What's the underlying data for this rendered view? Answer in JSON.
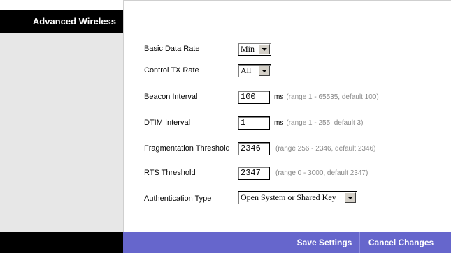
{
  "sidebar": {
    "title": "Advanced Wireless"
  },
  "fields": [
    {
      "label": "Basic Data Rate",
      "type": "select",
      "value": "Min"
    },
    {
      "label": "Control TX Rate",
      "type": "select",
      "value": "All"
    },
    {
      "label": "Beacon Interval",
      "type": "input",
      "value": "100",
      "unit": "ms",
      "hint": "(range 1 - 65535, default 100)"
    },
    {
      "label": "DTIM Interval",
      "type": "input",
      "value": "1",
      "unit": "ms",
      "hint": "(range 1 - 255, default 3)"
    },
    {
      "label": "Fragmentation Threshold",
      "type": "input",
      "value": "2346",
      "hint": "(range 256 - 2346, default 2346)"
    },
    {
      "label": "RTS Threshold",
      "type": "input",
      "value": "2347",
      "hint": "(range 0 - 3000, default 2347)"
    },
    {
      "label": "Authentication Type",
      "type": "select",
      "value": "Open System or Shared Key"
    }
  ],
  "footer": {
    "save_label": "Save Settings",
    "cancel_label": "Cancel Changes",
    "bar_color": "#6666cc"
  }
}
